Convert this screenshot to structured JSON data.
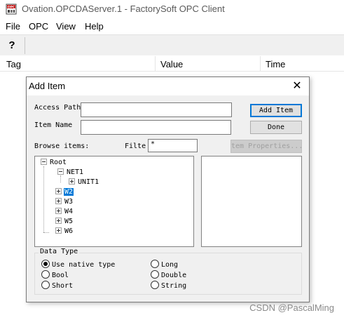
{
  "window": {
    "title": "Ovation.OPCDAServer.1 - FactorySoft OPC Client",
    "icon": "opc-app-icon"
  },
  "menu": [
    "File",
    "OPC",
    "View",
    "Help"
  ],
  "toolbar": {
    "help_glyph": "?"
  },
  "list": {
    "columns": [
      "Tag",
      "Value",
      "Time"
    ]
  },
  "dialog": {
    "title": "Add Item",
    "close_glyph": "✕",
    "access_path_label": "Access Path",
    "access_path_value": "",
    "item_name_label": "Item Name",
    "item_name_value": "",
    "add_item_button": "Add Item",
    "done_button": "Done",
    "browse_label": "Browse items:",
    "filter_label": "Filte",
    "filter_value": "*",
    "item_properties_button": "tem Properties...",
    "tree": [
      {
        "label": "Root",
        "expanded": true
      },
      {
        "label": "NET1",
        "expanded": true
      },
      {
        "label": "UNIT1",
        "expanded": false
      },
      {
        "label": "W2",
        "expanded": false,
        "selected": true
      },
      {
        "label": "W3",
        "expanded": false
      },
      {
        "label": "W4",
        "expanded": false
      },
      {
        "label": "W5",
        "expanded": false
      },
      {
        "label": "W6",
        "expanded": false
      }
    ],
    "data_type": {
      "title": "Data Type",
      "options": [
        "Use native type",
        "Long",
        "Bool",
        "Double",
        "Short",
        "String"
      ],
      "selected": "Use native type"
    }
  },
  "watermark": "CSDN @PascalMing"
}
